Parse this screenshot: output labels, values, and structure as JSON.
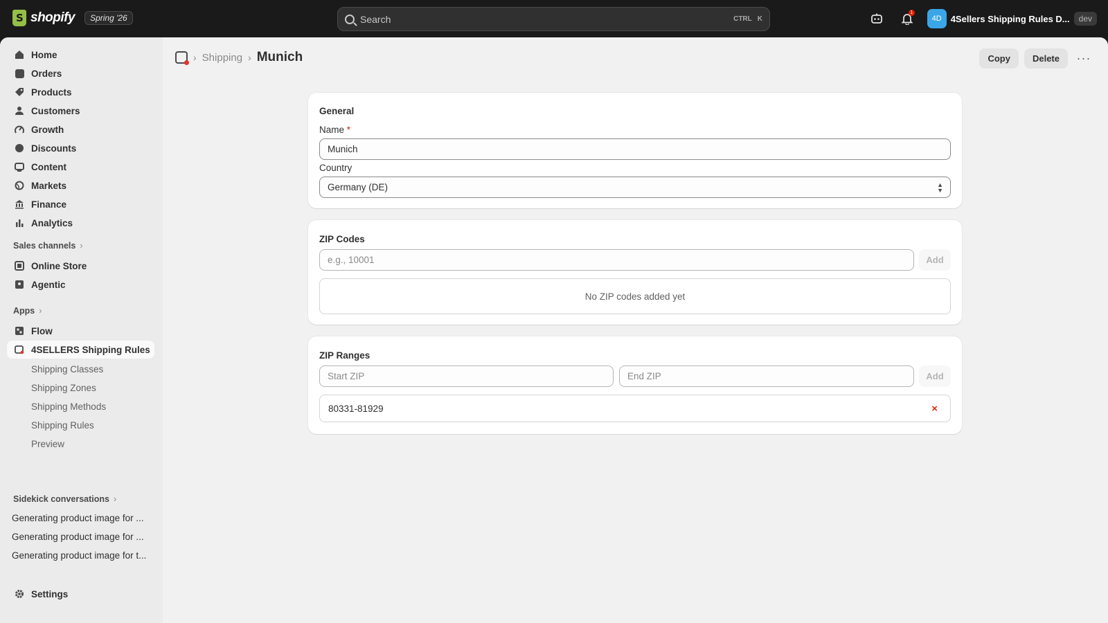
{
  "topbar": {
    "brand": "shopify",
    "edition": "Spring '26",
    "search_placeholder": "Search",
    "kbd_ctrl": "CTRL",
    "kbd_k": "K",
    "notif_count": "1",
    "avatar_initials": "4D",
    "store_name": "4Sellers Shipping Rules D...",
    "env_badge": "dev"
  },
  "sidebar": {
    "items": [
      {
        "label": "Home",
        "icon": "home-icon"
      },
      {
        "label": "Orders",
        "icon": "orders-icon"
      },
      {
        "label": "Products",
        "icon": "tag-icon"
      },
      {
        "label": "Customers",
        "icon": "person-icon"
      },
      {
        "label": "Growth",
        "icon": "growth-icon"
      },
      {
        "label": "Discounts",
        "icon": "discount-icon"
      },
      {
        "label": "Content",
        "icon": "content-icon"
      },
      {
        "label": "Markets",
        "icon": "globe-icon"
      },
      {
        "label": "Finance",
        "icon": "bank-icon"
      },
      {
        "label": "Analytics",
        "icon": "bar-chart-icon"
      }
    ],
    "sales_channels_label": "Sales channels",
    "sales_channels": [
      {
        "label": "Online Store",
        "icon": "store-icon"
      },
      {
        "label": "Agentic",
        "icon": "agent-icon"
      }
    ],
    "apps_label": "Apps",
    "apps": [
      {
        "label": "Flow",
        "icon": "flow-icon"
      },
      {
        "label": "4SELLERS Shipping Rules",
        "icon": "app-icon"
      }
    ],
    "app_subitems": [
      "Shipping Classes",
      "Shipping Zones",
      "Shipping Methods",
      "Shipping Rules",
      "Preview"
    ],
    "sidekick_label": "Sidekick conversations",
    "sidekick_items": [
      "Generating product image for ...",
      "Generating product image for ...",
      "Generating product image for t..."
    ],
    "settings_label": "Settings"
  },
  "page": {
    "breadcrumb_parent": "Shipping",
    "title": "Munich",
    "copy_label": "Copy",
    "delete_label": "Delete",
    "more_label": "···"
  },
  "general": {
    "title": "General",
    "name_label": "Name",
    "required_mark": "*",
    "name_value": "Munich",
    "country_label": "Country",
    "country_value": "Germany (DE)"
  },
  "zip_codes": {
    "title": "ZIP Codes",
    "placeholder": "e.g., 10001",
    "add_label": "Add",
    "empty_text": "No ZIP codes added yet"
  },
  "zip_ranges": {
    "title": "ZIP Ranges",
    "start_placeholder": "Start ZIP",
    "end_placeholder": "End ZIP",
    "add_label": "Add",
    "ranges": [
      "80331-81929"
    ],
    "remove_label": "×"
  },
  "colors": {
    "topbar_bg": "#1a1a1a",
    "accent_avatar": "#3aa6e8",
    "danger": "#d72c0d"
  }
}
